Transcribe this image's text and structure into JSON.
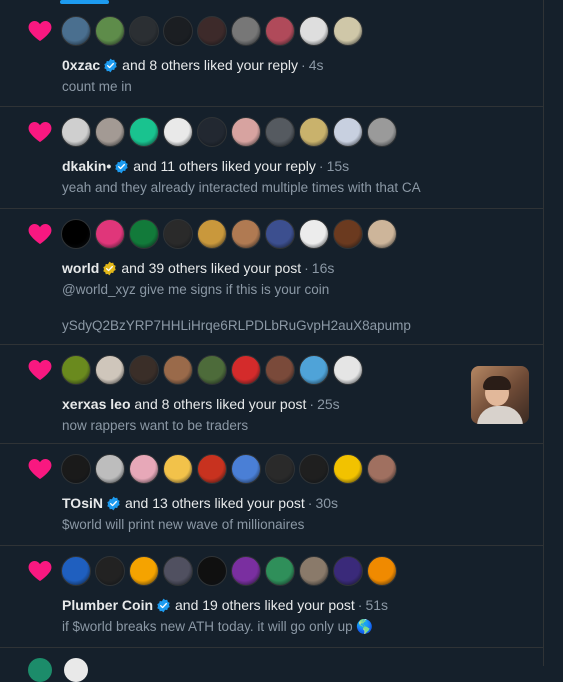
{
  "notifications": [
    {
      "actor": "0xzac",
      "verified": "blue",
      "action": "and 8 others liked your reply",
      "time": "4s",
      "text": [
        "count me in"
      ],
      "avatars": [
        "#4a6f8f",
        "#5e8c4a",
        "#2b2f33",
        "#1b1e22",
        "#3d2a2a",
        "#777777",
        "#b04a5a",
        "#dedede",
        "#cfc7a8"
      ]
    },
    {
      "actor": "dkakin•",
      "verified": "blue",
      "action": "and 11 others liked your reply",
      "time": "15s",
      "text": [
        "yeah and they already interacted multiple times with that CA"
      ],
      "avatars": [
        "#cfcfcf",
        "#a39a94",
        "#19c38f",
        "#e9e9e9",
        "#222831",
        "#d7a3a0",
        "#555a60",
        "#c9b26c",
        "#c8d0e0",
        "#9a9a9a"
      ]
    },
    {
      "actor": "world",
      "verified": "gold",
      "action": "and 39 others liked your post",
      "time": "16s",
      "text": [
        "@world_xyz give me signs if this is your coin",
        "",
        "ySdyQ2BzYRP7HHLiHrqe6RLPDLbRuGvpH2auX8apump"
      ],
      "avatars": [
        "#000000",
        "#e0367a",
        "#127a3a",
        "#2a2a2a",
        "#c9983c",
        "#b07a52",
        "#3c4f8f",
        "#ececec",
        "#6b3a1f",
        "#cdb59a"
      ]
    },
    {
      "actor": "xerxas leo",
      "verified": "none",
      "action": "and 8 others liked your post",
      "time": "25s",
      "text": [
        "now rappers want to be traders"
      ],
      "avatars": [
        "#6a8a1e",
        "#cfc6bb",
        "#3a2e28",
        "#9a6a4a",
        "#4d6b3a",
        "#d42b2b",
        "#7a4a3a",
        "#4fa3d8",
        "#e5e5e5"
      ],
      "has_media": true
    },
    {
      "actor": "TOsiN",
      "verified": "blue",
      "action": "and 13 others liked your post",
      "time": "30s",
      "text": [
        "$world will print new wave of millionaires"
      ],
      "avatars": [
        "#1a1a1a",
        "#bdbdbd",
        "#e7a8b8",
        "#f2c24a",
        "#c8321f",
        "#4a7fd6",
        "#2a2a2a",
        "#1f1f1f",
        "#f2c200",
        "#a07060"
      ]
    },
    {
      "actor": "Plumber Coin",
      "verified": "blue",
      "action": "and 19 others liked your post",
      "time": "51s",
      "text": [
        "if $world breaks new ATH today. it will go only up 🌎"
      ],
      "avatars": [
        "#1f5fbf",
        "#222222",
        "#f5a300",
        "#505060",
        "#101010",
        "#7a2fa0",
        "#2f8f5a",
        "#8a7a6a",
        "#3a2a7a",
        "#f08a00"
      ]
    }
  ],
  "colors": {
    "background": "#15202b",
    "heart": "#f91880",
    "verified_blue": "#1d9bf0",
    "verified_gold": "#e2b719",
    "separator": "#2f3336",
    "secondary_text": "#8b98a5"
  }
}
